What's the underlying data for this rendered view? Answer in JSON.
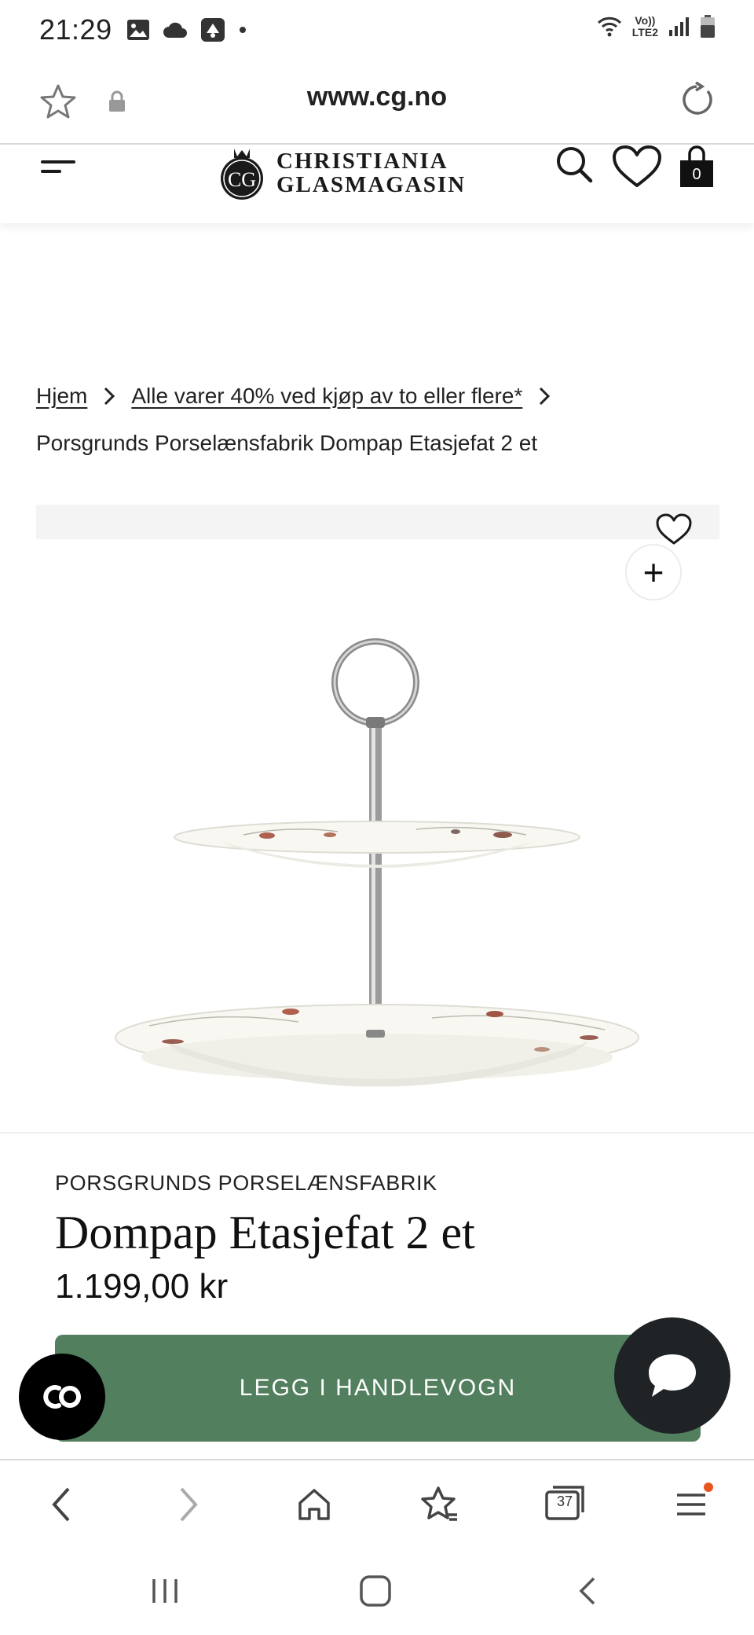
{
  "status_bar": {
    "time": "21:29",
    "network_label_top": "Vo))",
    "network_label_bottom": "LTE2",
    "icons": [
      "image-icon",
      "cloud-icon",
      "app-icon",
      "dot-icon",
      "wifi-icon",
      "signal-icon",
      "battery-icon"
    ]
  },
  "url_bar": {
    "url": "www.cg.no"
  },
  "header": {
    "logo_monogram": "CG",
    "logo_line1": "CHRISTIANIA",
    "logo_line2": "GLASMAGASIN",
    "cart_count": "0"
  },
  "breadcrumb": {
    "items": [
      "Hjem",
      "Alle varer 40% ved kjøp av to eller flere*"
    ],
    "current": "Porsgrunds Porselænsfabrik Dompap Etasjefat 2 et"
  },
  "product": {
    "brand": "PORSGRUNDS PORSELÆNSFABRIK",
    "title": "Dompap Etasjefat 2 et",
    "price": "1.199,00 kr",
    "add_to_cart_label": "LEGG I HANDLEVOGN",
    "zoom_label": "+"
  },
  "widgets": {
    "co_badge_text": "CO"
  },
  "browser_bar": {
    "tabs_count": "37"
  },
  "colors": {
    "accent_green": "#527f5e",
    "chat_dark": "#1f2326",
    "notification_orange": "#e8561f"
  }
}
